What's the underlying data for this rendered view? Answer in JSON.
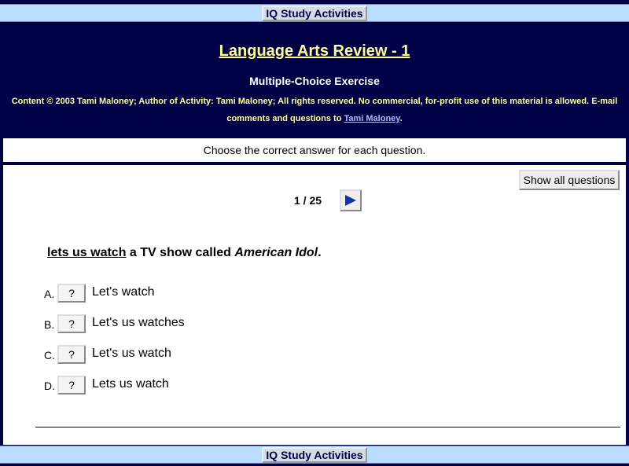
{
  "nav": {
    "label": "IQ Study Activities"
  },
  "header": {
    "title": "Language Arts Review - 1",
    "subtitle": "Multiple-Choice Exercise",
    "credits_text": "Content © 2003 Tami Maloney; Author of Activity: Tami Maloney; All rights reserved. No commercial, for-profit use of this material is allowed. E-mail comments and questions to ",
    "credits_link": "Tami Maloney",
    "credits_end": "."
  },
  "instructions": "Choose the correct answer for each question.",
  "quiz": {
    "show_all_label": "Show all questions",
    "counter": "1 / 25",
    "question": {
      "underlined": "lets us watch",
      "middle": " a TV show called ",
      "italic": "American Idol",
      "end": "."
    },
    "options": [
      {
        "letter": "A.",
        "button": "?",
        "text": "Let's watch"
      },
      {
        "letter": "B.",
        "button": "?",
        "text": "Let's us watches"
      },
      {
        "letter": "C.",
        "button": "?",
        "text": "Let's us watch"
      },
      {
        "letter": "D.",
        "button": "?",
        "text": "Lets us watch"
      }
    ]
  },
  "colors": {
    "background": "#000044",
    "title": "#ffff99",
    "navbar": "#bbddff",
    "arrow": "#1133aa"
  },
  "icons": {
    "next": "right-arrow-icon"
  }
}
